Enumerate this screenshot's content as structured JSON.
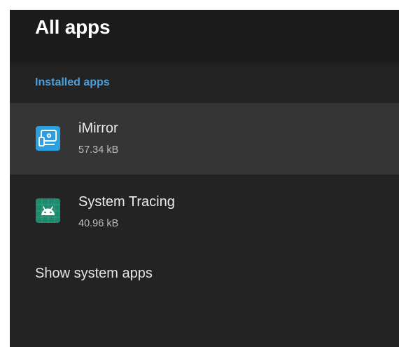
{
  "header": {
    "title": "All apps"
  },
  "section": {
    "label": "Installed apps"
  },
  "apps": [
    {
      "name": "iMirror",
      "size": "57.34 kB",
      "icon": "imirror-app-icon"
    },
    {
      "name": "System Tracing",
      "size": "40.96 kB",
      "icon": "android-app-icon"
    }
  ],
  "actions": {
    "show_system_apps": "Show system apps"
  },
  "colors": {
    "background": "#232323",
    "header": "#1b1b1b",
    "focused_row": "#353535",
    "accent": "#4a9fe0",
    "imirror_icon": "#2c9fe0",
    "android_icon": "#1f8a6e"
  }
}
